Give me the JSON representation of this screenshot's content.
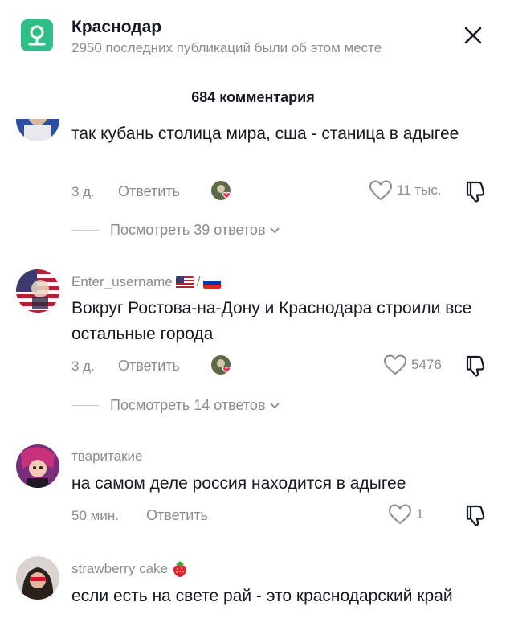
{
  "header": {
    "location_title": "Краснодар",
    "location_subtitle": "2950 последних публикаций были об этом месте",
    "icon": "map-pin-icon",
    "close_icon": "close-icon"
  },
  "comments_count_label": "684 комментария",
  "comments": [
    {
      "username": "",
      "text": "так кубань столица мира, сша - станица в адыгее",
      "time": "3 д.",
      "reply_label": "Ответить",
      "likes": "11 тыс.",
      "view_replies": "Посмотреть 39 ответов"
    },
    {
      "username": "Enter_username",
      "username_suffix": "/",
      "text": "Вокруг Ростова-на-Дону и Краснодара строили все остальные города",
      "time": "3 д.",
      "reply_label": "Ответить",
      "likes": "5476",
      "view_replies": "Посмотреть 14 ответов"
    },
    {
      "username": "тваритакие",
      "text": "на самом деле россия находится в адыгее",
      "time": "50 мин.",
      "reply_label": "Ответить",
      "likes": "1"
    },
    {
      "username": "strawberry cake",
      "text": "если есть на свете рай - это краснодарский край"
    }
  ],
  "colors": {
    "accent_pin": "#2fbf86",
    "secondary_text": "#8a8b91",
    "primary_text": "#161823",
    "liked_heart": "#fe2c55"
  }
}
